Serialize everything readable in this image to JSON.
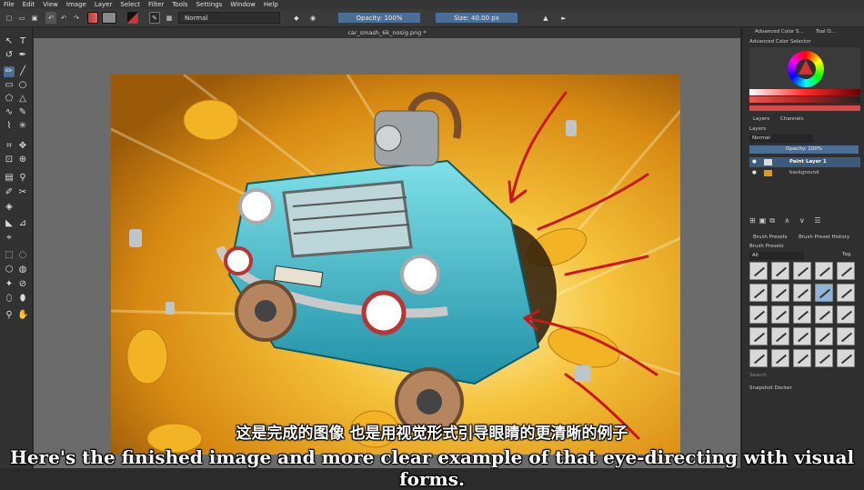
{
  "menu": [
    "File",
    "Edit",
    "View",
    "Image",
    "Layer",
    "Select",
    "Filter",
    "Tools",
    "Settings",
    "Window",
    "Help"
  ],
  "toolbar": {
    "blend_mode": "Normal",
    "opacity_label": "Opacity: 100%",
    "size_label": "Size: 40.00 px"
  },
  "document": {
    "tab_title": "car_smash_6k_nosig.png *"
  },
  "dockers": {
    "tabs": [
      "Advanced Color S...",
      "Tool O..."
    ],
    "color_selector_title": "Advanced Color Selector",
    "layer_tabs": [
      "Layers",
      "Channels"
    ],
    "layers_header": "Layers",
    "layer_blend": "Normal",
    "layer_opacity": "Opacity:  100%",
    "layers": [
      {
        "name": "Paint Layer 1",
        "active": true
      },
      {
        "name": "background",
        "active": false
      }
    ],
    "brush_tabs": [
      "Brush Presets",
      "Brush Preset History"
    ],
    "brush_presets_title": "Brush Presets",
    "brush_filter": "All",
    "brush_tag": "Tag",
    "search_placeholder": "Search",
    "snapshot_title": "Snapshot Docker"
  },
  "subtitles": {
    "chinese": "这是完成的图像 也是用视觉形式引导眼睛的更清晰的例子",
    "english": "Here's the finished image and more clear example of that eye-directing with visual forms."
  },
  "colors": {
    "accent": "#4a6e95",
    "bg": "#2b2b2b",
    "canvas_bg": "#6b6b6b"
  }
}
